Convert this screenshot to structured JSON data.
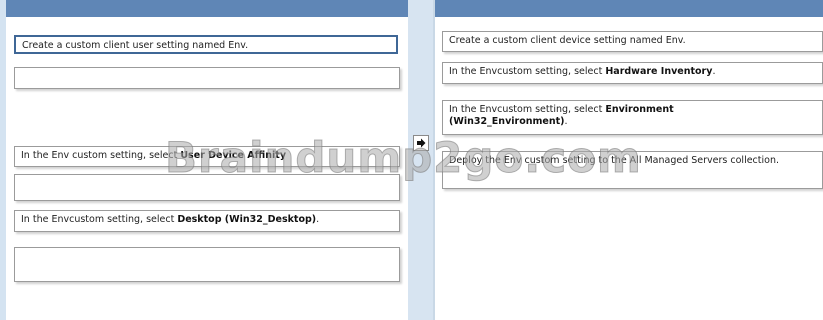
{
  "left_panel": {
    "items": [
      {
        "text": "Create a custom client user setting named Env.",
        "bold": ""
      },
      {
        "text": "",
        "bold": ""
      },
      {
        "text": "In the Env custom setting, select ",
        "bold": "User Device Affinity"
      },
      {
        "text": "",
        "bold": ""
      },
      {
        "text": "In the Envcustom setting, select ",
        "bold": "Desktop (Win32_Desktop)",
        "suffix": "."
      },
      {
        "text": "",
        "bold": ""
      }
    ]
  },
  "right_panel": {
    "items": [
      {
        "text": "Create a custom client device setting named Env.",
        "bold": ""
      },
      {
        "text": "In the Envcustom setting, select ",
        "bold": "Hardware Inventory",
        "suffix": "."
      },
      {
        "text": "In the Envcustom setting, select ",
        "bold": "Environment (Win32_Environment)",
        "suffix": "."
      },
      {
        "text": "Deploy the Env custom setting to the All Managed Servers collection.",
        "bold": ""
      }
    ]
  },
  "move_button": {
    "icon": "right-arrow-icon"
  },
  "watermark": "Braindump2go.com",
  "colors": {
    "header": "#5f86b6",
    "divider": "#d7e4f1",
    "selected_border": "#3f6796"
  }
}
